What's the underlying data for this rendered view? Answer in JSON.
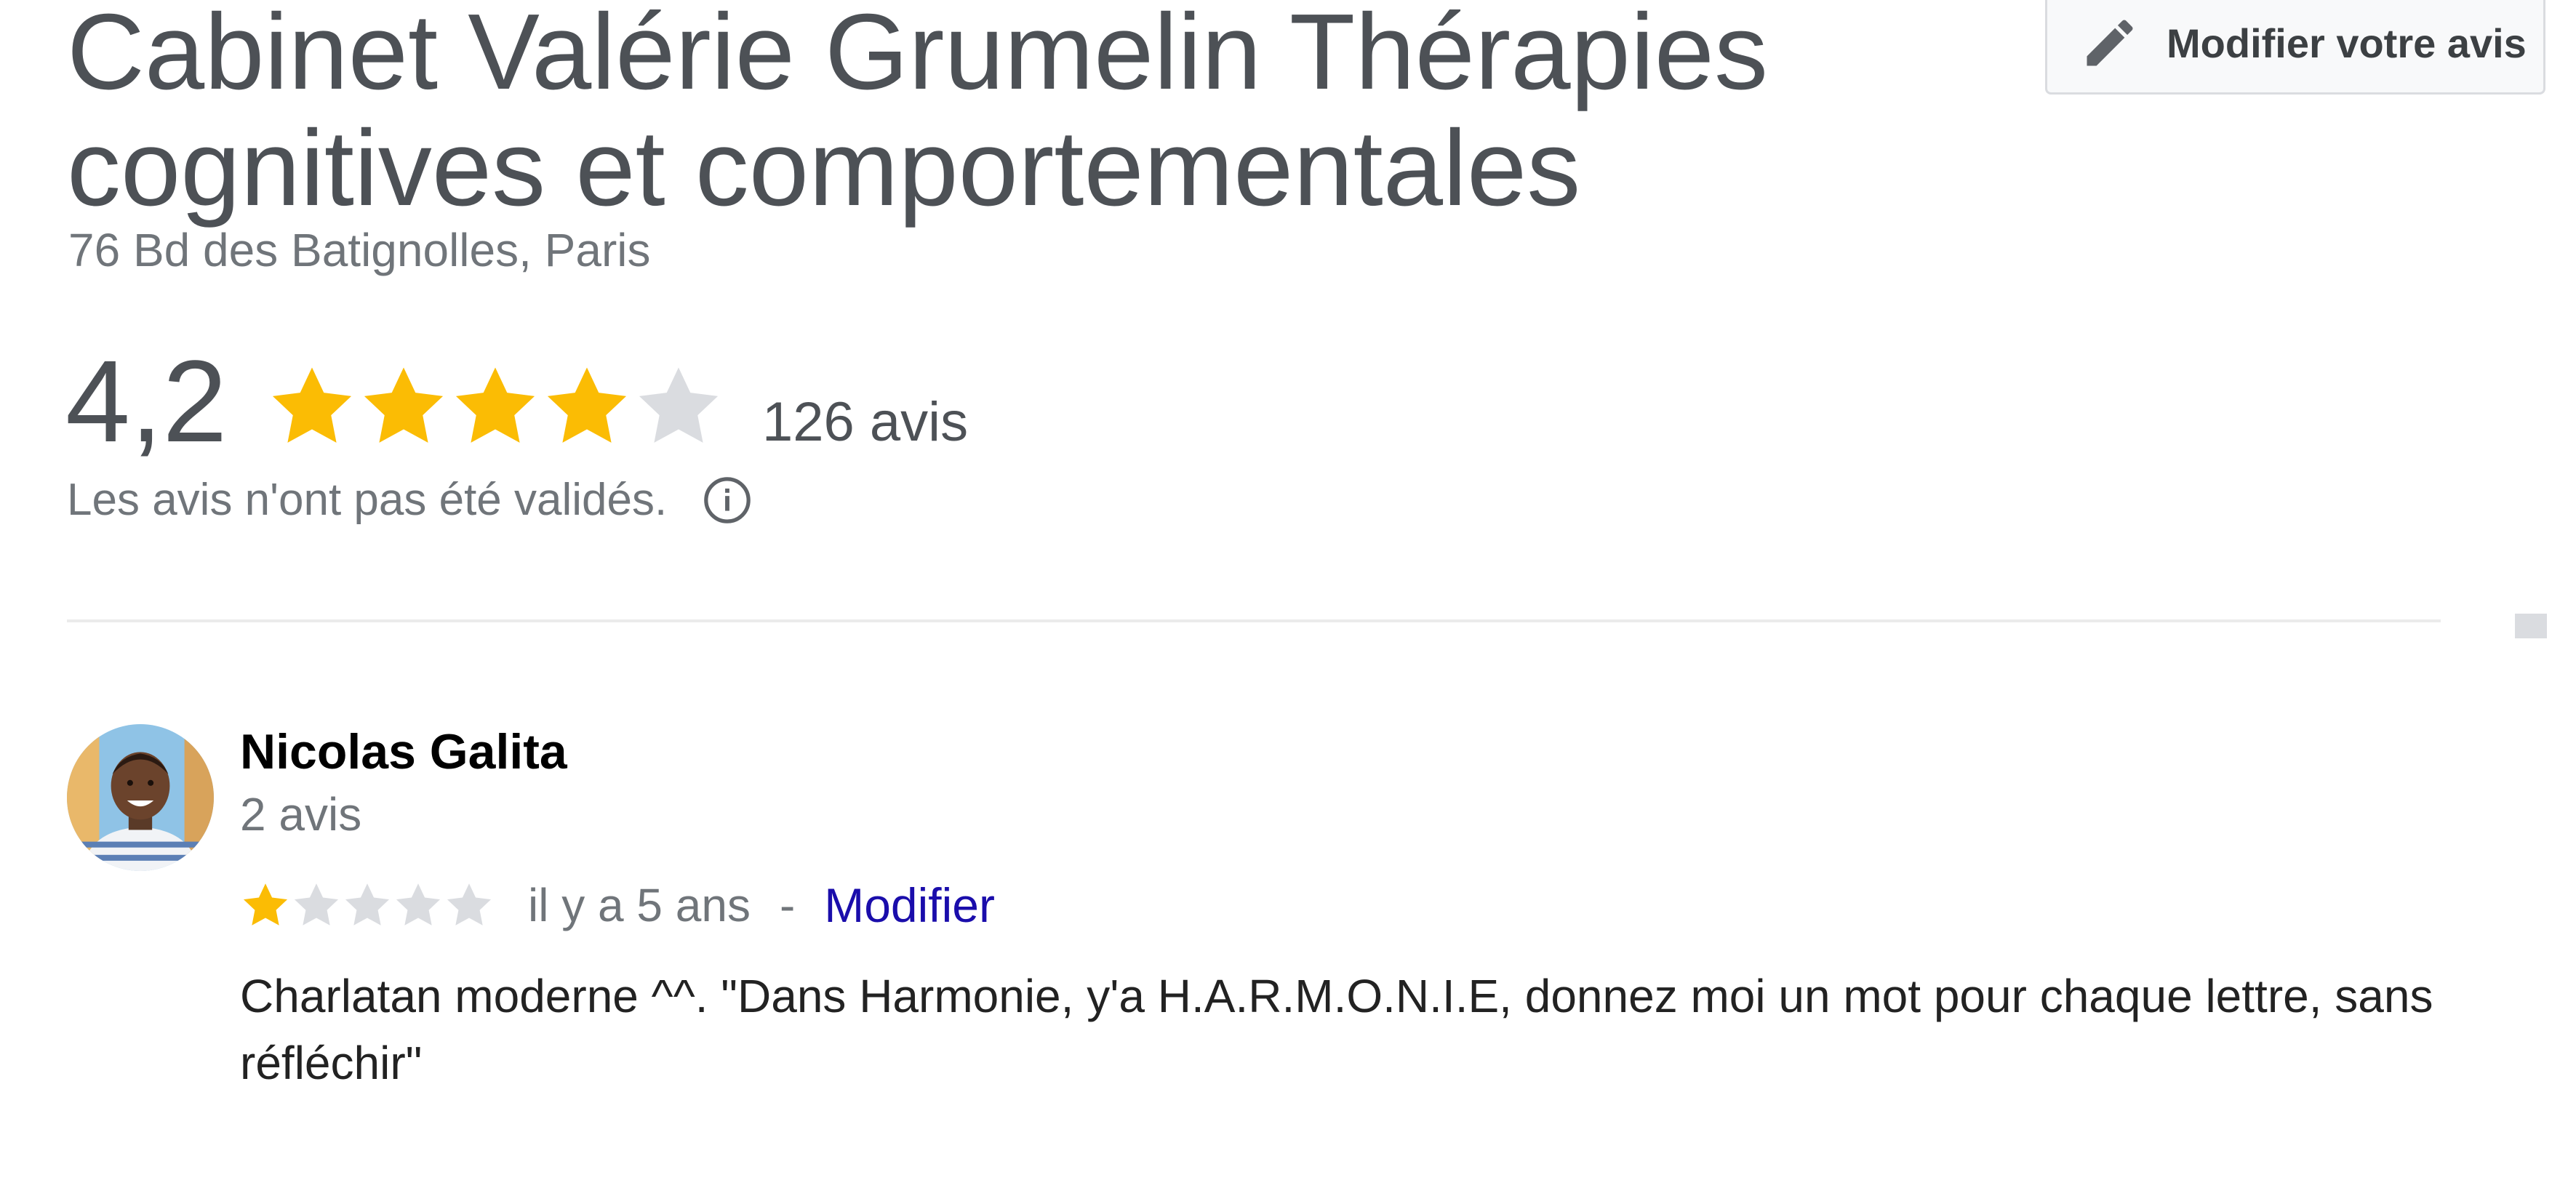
{
  "business": {
    "title": "Cabinet Valérie Grumelin Thérapies cognitives et comportementales",
    "address": "76 Bd des Batignolles, Paris"
  },
  "actions": {
    "edit_review_label": "Modifier votre avis",
    "edit_icon": "pencil-icon"
  },
  "rating": {
    "value": "4,2",
    "stars_filled": 4,
    "stars_total": 5,
    "count_label": "126 avis",
    "unverified_note": "Les avis n'ont pas été validés.",
    "info_icon": "info-icon"
  },
  "colors": {
    "star_filled": "#fbbc04",
    "star_empty": "#dadce0",
    "link": "#1a0dab",
    "muted_text": "#70757a"
  },
  "review": {
    "author": "Nicolas Galita",
    "author_review_count": "2 avis",
    "stars_filled": 1,
    "stars_total": 5,
    "time": "il y a 5 ans",
    "separator": "-",
    "edit_label": "Modifier",
    "text": "Charlatan moderne ^^. \"Dans Harmonie, y'a H.A.R.M.O.N.I.E, donnez moi un mot pour chaque lettre, sans réfléchir\""
  }
}
